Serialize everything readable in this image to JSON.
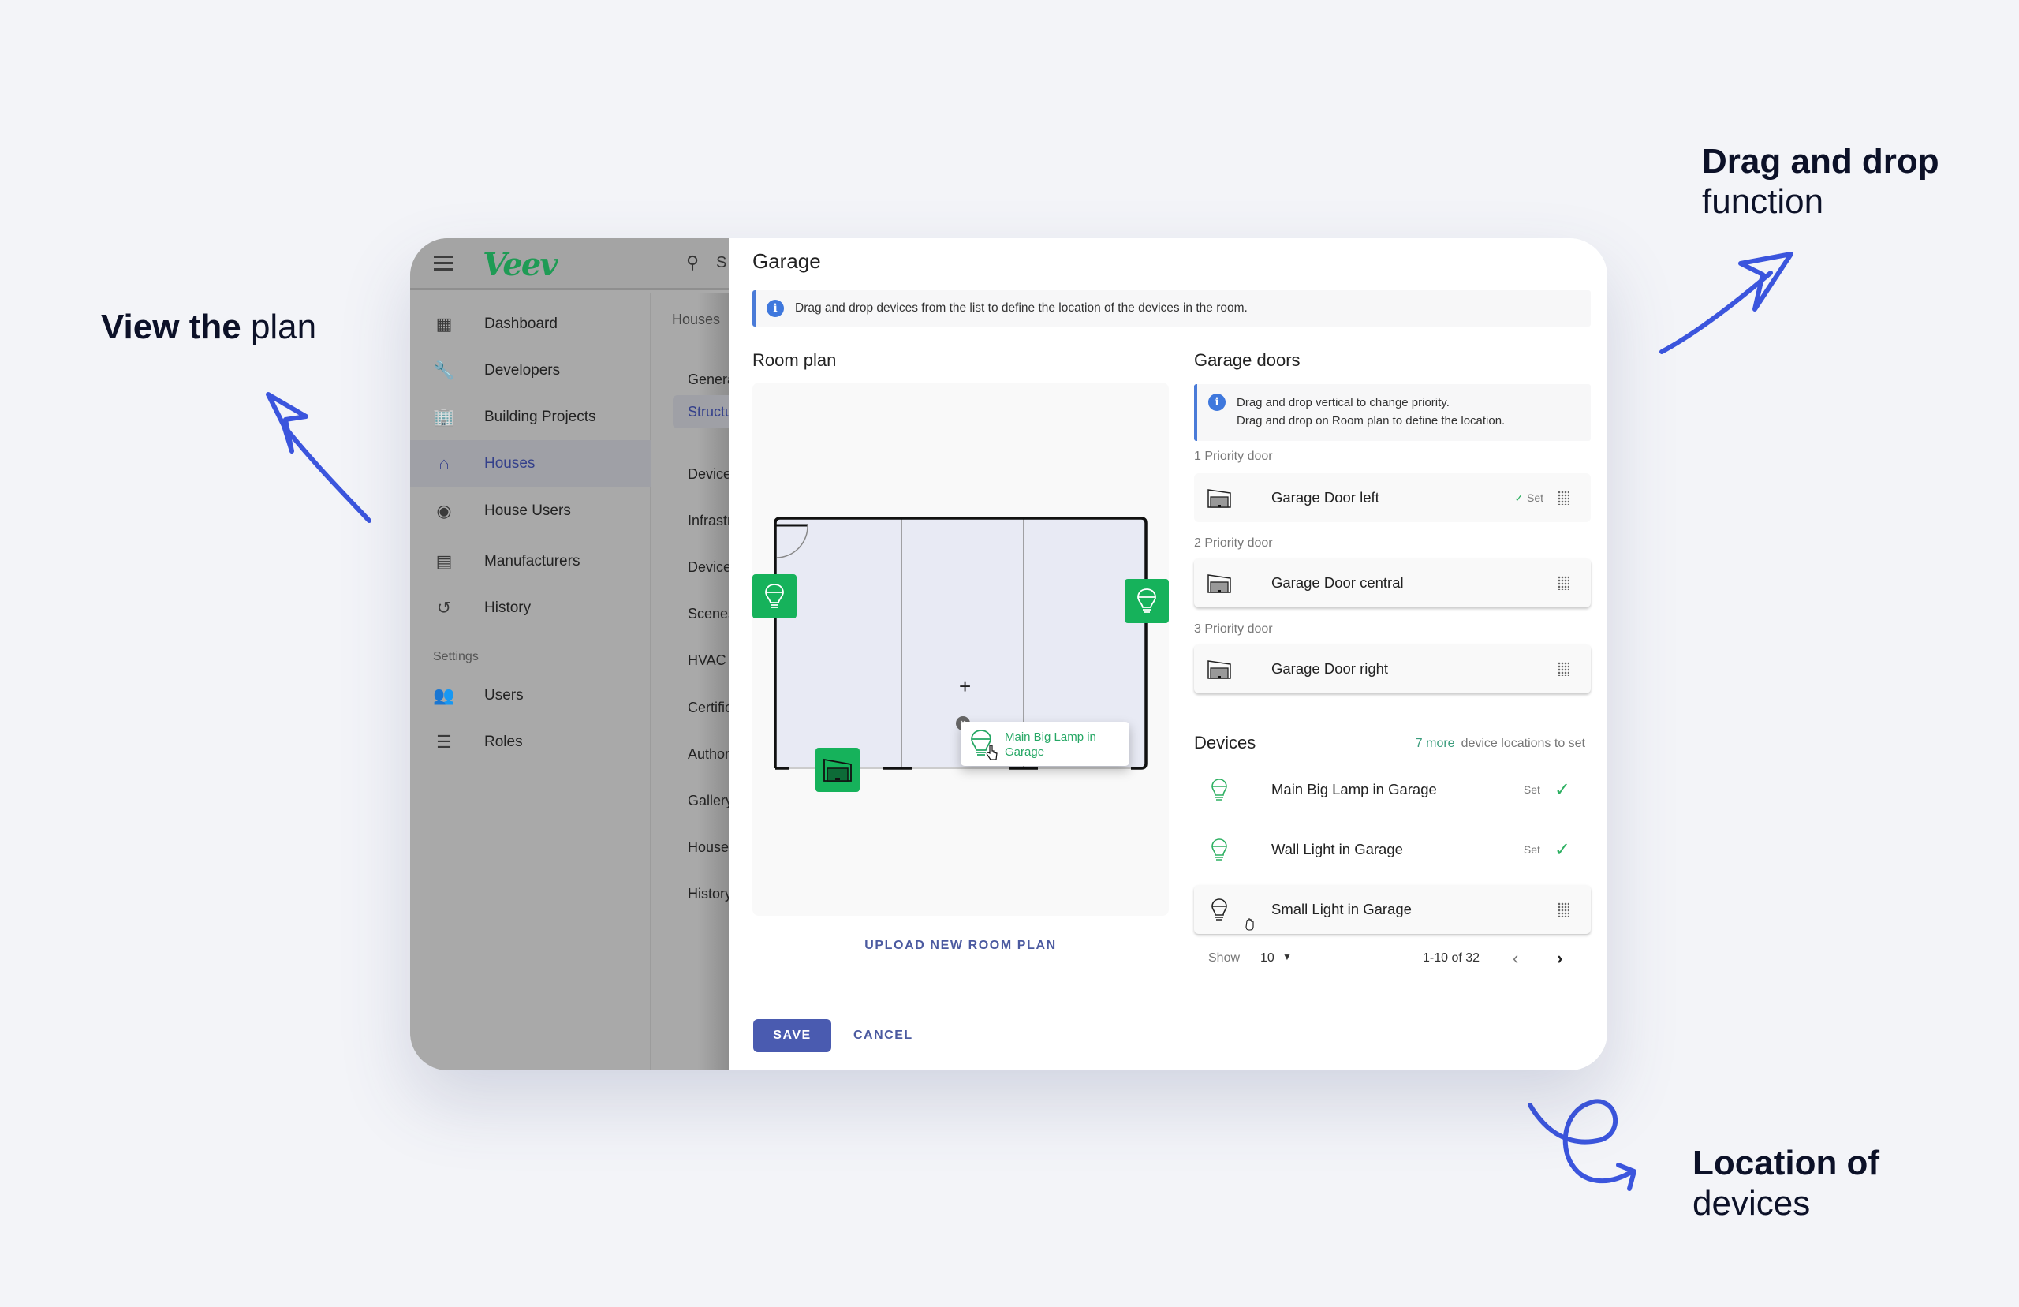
{
  "annotations": {
    "view_plan": {
      "bold": "View the",
      "light": "plan"
    },
    "drag_drop": {
      "bold": "Drag and drop",
      "light": "function"
    },
    "location": {
      "bold": "Location of",
      "light": "devices"
    },
    "arrow_color": "#3b55dd"
  },
  "app": {
    "logo": "Veev",
    "search_placeholder": "S",
    "sidebar": {
      "items": [
        {
          "label": "Dashboard",
          "icon": "dashboard-icon"
        },
        {
          "label": "Developers",
          "icon": "wrench-icon"
        },
        {
          "label": "Building Projects",
          "icon": "buildings-icon"
        },
        {
          "label": "Houses",
          "icon": "houses-icon",
          "active": true
        },
        {
          "label": "House Users",
          "icon": "house-users-icon"
        },
        {
          "label": "Manufacturers",
          "icon": "manufacturers-icon"
        },
        {
          "label": "History",
          "icon": "history-icon"
        }
      ],
      "settings_label": "Settings",
      "settings_items": [
        {
          "label": "Users",
          "icon": "users-icon"
        },
        {
          "label": "Roles",
          "icon": "roles-icon"
        }
      ]
    },
    "subnav": {
      "breadcrumb": "Houses",
      "items": [
        "General",
        "Structure",
        "Devices",
        "Infrastructure",
        "Devices",
        "Scenes",
        "HVAC",
        "Certificates",
        "Authorizations",
        "Gallery",
        "House",
        "History"
      ],
      "active_index": 1
    }
  },
  "dialog": {
    "title": "Garage",
    "info": "Drag and drop devices from the list to define the location of the devices in the room.",
    "room_plan": {
      "title": "Room plan",
      "dragging_label": "Main Big Lamp in Garage",
      "upload_label": "UPLOAD NEW ROOM PLAN"
    },
    "garage_doors": {
      "title": "Garage doors",
      "info_lines": [
        "Drag and drop vertical to change priority.",
        "Drag and drop on Room plan to define the location."
      ],
      "doors": [
        {
          "priority": "1 Priority door",
          "name": "Garage Door left",
          "status": "Set"
        },
        {
          "priority": "2 Priority door",
          "name": "Garage Door central",
          "status": ""
        },
        {
          "priority": "3 Priority door",
          "name": "Garage Door right",
          "status": ""
        }
      ]
    },
    "devices": {
      "title": "Devices",
      "more_count": "7 more",
      "more_text": "device locations to set",
      "items": [
        {
          "name": "Main Big Lamp in Garage",
          "status": "Set"
        },
        {
          "name": "Wall Light in Garage",
          "status": "Set"
        },
        {
          "name": "Small Light in Garage",
          "status": ""
        }
      ],
      "pagination": {
        "show_label": "Show",
        "page_size": "10",
        "range": "1-10 of 32"
      }
    },
    "save_label": "SAVE",
    "cancel_label": "CANCEL",
    "colors": {
      "accent": "#4a5bb0",
      "green": "#16b25b",
      "info": "#3f78dd"
    }
  }
}
